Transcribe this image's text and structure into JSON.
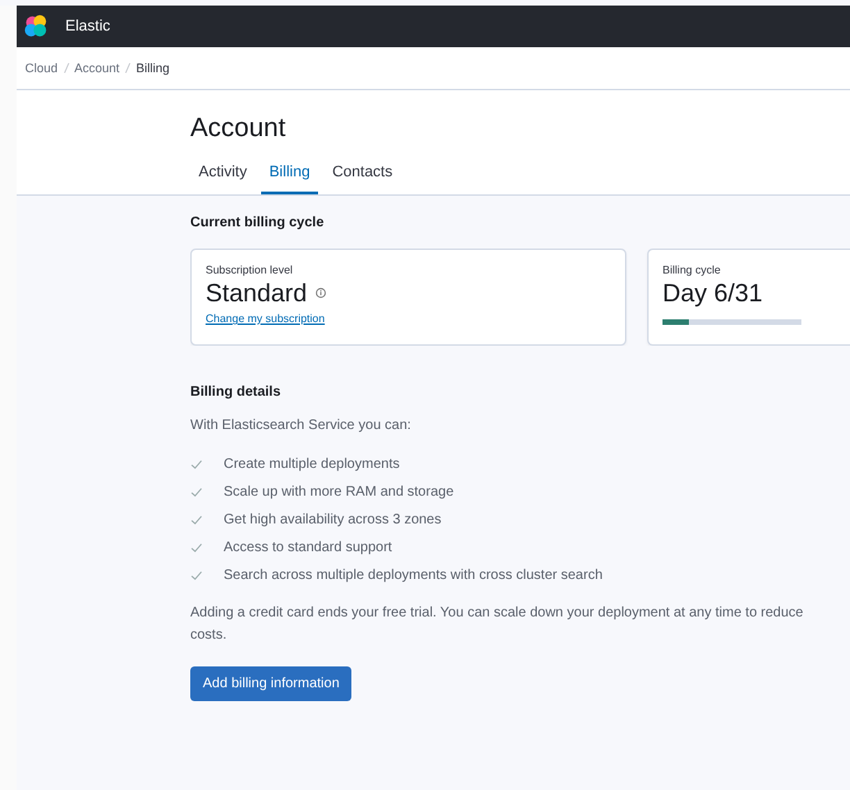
{
  "header": {
    "brand": "Elastic"
  },
  "breadcrumbs": [
    "Cloud",
    "Account",
    "Billing"
  ],
  "page_title": "Account",
  "tabs": [
    {
      "label": "Activity",
      "selected": false
    },
    {
      "label": "Billing",
      "selected": true
    },
    {
      "label": "Contacts",
      "selected": false
    }
  ],
  "current_billing_cycle": {
    "title": "Current billing cycle",
    "cards": [
      {
        "kind": "subscription",
        "label": "Subscription level",
        "value": "Standard",
        "link": "Change my subscription"
      },
      {
        "kind": "cycle",
        "label": "Billing cycle",
        "value": "Day 6/31",
        "level": 0.19
      }
    ]
  },
  "billing_details": {
    "title": "Billing details",
    "intro": "With Elasticsearch Service you can:",
    "features": [
      "Create multiple deployments",
      "Scale up with more RAM and storage",
      "Get high availability across 3 zones",
      "Access to standard support",
      "Search across multiple deployments with cross cluster search"
    ],
    "note": "Adding a credit card ends your free trial. You can scale down your deployment at any time to reduce costs.",
    "button": "Add billing information"
  }
}
